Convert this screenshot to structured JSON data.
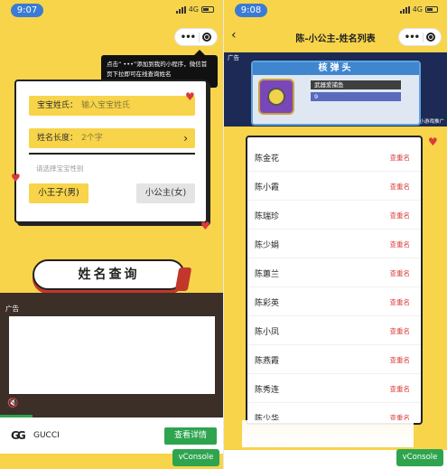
{
  "left": {
    "status": {
      "time": "9:07",
      "network": "4G"
    },
    "tooltip": {
      "text": "点击“ •••”添加到我的小程序，微信首页下拉即可在线查询姓名"
    },
    "form": {
      "surname_label": "宝宝姓氏：",
      "surname_placeholder": "输入宝宝姓氏",
      "length_label": "姓名长度：",
      "length_value": "2个字",
      "gender_label": "请选择宝宝性别",
      "boy_button": "小王子(男)",
      "girl_button": "小公主(女)"
    },
    "query_button": "姓名查询",
    "ad": {
      "tag": "广告",
      "brand": "GUCCI",
      "logo": "GG",
      "cta": "查看详情"
    },
    "vconsole": "vConsole"
  },
  "right": {
    "status": {
      "time": "9:08",
      "network": "4G"
    },
    "title": "陈-小公主-姓名列表",
    "banner": {
      "tag": "广告",
      "header": "核弹头",
      "item_text": "武器爱捕鱼",
      "item_count": "9",
      "footer": "小游戏推广"
    },
    "names": [
      {
        "name": "陈金花",
        "action": "查重名"
      },
      {
        "name": "陈小霞",
        "action": "查重名"
      },
      {
        "name": "陈瑞珍",
        "action": "查重名"
      },
      {
        "name": "陈少娟",
        "action": "查重名"
      },
      {
        "name": "陈蕙兰",
        "action": "查重名"
      },
      {
        "name": "陈彩英",
        "action": "查重名"
      },
      {
        "name": "陈小凤",
        "action": "查重名"
      },
      {
        "name": "陈燕霞",
        "action": "查重名"
      },
      {
        "name": "陈秀连",
        "action": "查重名"
      },
      {
        "name": "陈少华",
        "action": "查重名"
      }
    ],
    "vconsole": "vConsole"
  },
  "colors": {
    "background": "#f7d44a",
    "accent_red": "#d93b3b",
    "green": "#2ea44f"
  },
  "icons": [
    "back-icon",
    "more-icon",
    "target-icon",
    "chevron-right-icon",
    "mute-icon",
    "heart-icon"
  ]
}
